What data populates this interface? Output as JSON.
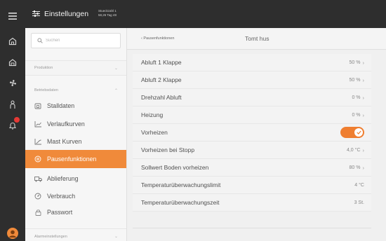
{
  "header": {
    "title": "Einstellungen",
    "meta_line1": "Stueckzahl 1",
    "meta_line2": "58,26 Tag 48"
  },
  "rail": {
    "icons": [
      "menu-icon",
      "home-icon",
      "barn-icon",
      "fan-icon",
      "person-icon",
      "bell-icon",
      "user-avatar"
    ]
  },
  "sidebar": {
    "search_placeholder": "Suchen",
    "groups": [
      {
        "label": "Produktion",
        "chevron": "⌄"
      },
      {
        "label": "Betriebsdaten",
        "chevron": "⌃"
      },
      {
        "label": "Alarmeinstellungen",
        "chevron": "⌄"
      }
    ],
    "items": [
      {
        "label": "Stalldaten",
        "icon": "barn-icon"
      },
      {
        "label": "Verlaufkurven",
        "icon": "chart-icon"
      },
      {
        "label": "Mast Kurven",
        "icon": "curve-icon"
      },
      {
        "label": "Pausenfunktionen",
        "icon": "pause-icon",
        "active": true
      },
      {
        "label": "Ablieferung",
        "icon": "truck-icon"
      },
      {
        "label": "Verbrauch",
        "icon": "gauge-icon"
      },
      {
        "label": "Passwort",
        "icon": "lock-icon"
      }
    ]
  },
  "main": {
    "back_label": "‹ Pausenfunktionen",
    "farm_name": "Tomt hus",
    "rows": [
      {
        "label": "Abluft 1 Klappe",
        "value": "50 %",
        "chevron": "›"
      },
      {
        "label": "Abluft 2 Klappe",
        "value": "50 %",
        "chevron": "›"
      },
      {
        "label": "Drehzahl Abluft",
        "value": "0 %",
        "chevron": "›"
      },
      {
        "label": "Heizung",
        "value": "0 %",
        "chevron": "›"
      },
      {
        "label": "Vorheizen",
        "value": "",
        "toggle": true
      },
      {
        "label": "Vorheizen bei Stopp",
        "value": "4,0 °C",
        "chevron": "›"
      },
      {
        "label": "Sollwert Boden vorheizen",
        "value": "80 %",
        "chevron": "›"
      },
      {
        "label": "Temperaturüberwachungslimit",
        "value": "4 °C",
        "chevron": ""
      },
      {
        "label": "Temperaturüberwachungszeit",
        "value": "3 St.",
        "chevron": ""
      }
    ]
  },
  "colors": {
    "accent": "#f08a3a",
    "rail": "#2e2e2e",
    "alert": "#e53935"
  }
}
